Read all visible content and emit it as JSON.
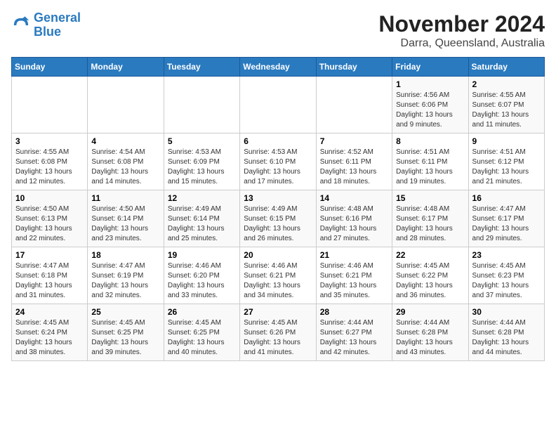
{
  "header": {
    "logo_line1": "General",
    "logo_line2": "Blue",
    "month": "November 2024",
    "location": "Darra, Queensland, Australia"
  },
  "weekdays": [
    "Sunday",
    "Monday",
    "Tuesday",
    "Wednesday",
    "Thursday",
    "Friday",
    "Saturday"
  ],
  "weeks": [
    [
      {
        "day": "",
        "info": ""
      },
      {
        "day": "",
        "info": ""
      },
      {
        "day": "",
        "info": ""
      },
      {
        "day": "",
        "info": ""
      },
      {
        "day": "",
        "info": ""
      },
      {
        "day": "1",
        "info": "Sunrise: 4:56 AM\nSunset: 6:06 PM\nDaylight: 13 hours\nand 9 minutes."
      },
      {
        "day": "2",
        "info": "Sunrise: 4:55 AM\nSunset: 6:07 PM\nDaylight: 13 hours\nand 11 minutes."
      }
    ],
    [
      {
        "day": "3",
        "info": "Sunrise: 4:55 AM\nSunset: 6:08 PM\nDaylight: 13 hours\nand 12 minutes."
      },
      {
        "day": "4",
        "info": "Sunrise: 4:54 AM\nSunset: 6:08 PM\nDaylight: 13 hours\nand 14 minutes."
      },
      {
        "day": "5",
        "info": "Sunrise: 4:53 AM\nSunset: 6:09 PM\nDaylight: 13 hours\nand 15 minutes."
      },
      {
        "day": "6",
        "info": "Sunrise: 4:53 AM\nSunset: 6:10 PM\nDaylight: 13 hours\nand 17 minutes."
      },
      {
        "day": "7",
        "info": "Sunrise: 4:52 AM\nSunset: 6:11 PM\nDaylight: 13 hours\nand 18 minutes."
      },
      {
        "day": "8",
        "info": "Sunrise: 4:51 AM\nSunset: 6:11 PM\nDaylight: 13 hours\nand 19 minutes."
      },
      {
        "day": "9",
        "info": "Sunrise: 4:51 AM\nSunset: 6:12 PM\nDaylight: 13 hours\nand 21 minutes."
      }
    ],
    [
      {
        "day": "10",
        "info": "Sunrise: 4:50 AM\nSunset: 6:13 PM\nDaylight: 13 hours\nand 22 minutes."
      },
      {
        "day": "11",
        "info": "Sunrise: 4:50 AM\nSunset: 6:14 PM\nDaylight: 13 hours\nand 23 minutes."
      },
      {
        "day": "12",
        "info": "Sunrise: 4:49 AM\nSunset: 6:14 PM\nDaylight: 13 hours\nand 25 minutes."
      },
      {
        "day": "13",
        "info": "Sunrise: 4:49 AM\nSunset: 6:15 PM\nDaylight: 13 hours\nand 26 minutes."
      },
      {
        "day": "14",
        "info": "Sunrise: 4:48 AM\nSunset: 6:16 PM\nDaylight: 13 hours\nand 27 minutes."
      },
      {
        "day": "15",
        "info": "Sunrise: 4:48 AM\nSunset: 6:17 PM\nDaylight: 13 hours\nand 28 minutes."
      },
      {
        "day": "16",
        "info": "Sunrise: 4:47 AM\nSunset: 6:17 PM\nDaylight: 13 hours\nand 29 minutes."
      }
    ],
    [
      {
        "day": "17",
        "info": "Sunrise: 4:47 AM\nSunset: 6:18 PM\nDaylight: 13 hours\nand 31 minutes."
      },
      {
        "day": "18",
        "info": "Sunrise: 4:47 AM\nSunset: 6:19 PM\nDaylight: 13 hours\nand 32 minutes."
      },
      {
        "day": "19",
        "info": "Sunrise: 4:46 AM\nSunset: 6:20 PM\nDaylight: 13 hours\nand 33 minutes."
      },
      {
        "day": "20",
        "info": "Sunrise: 4:46 AM\nSunset: 6:21 PM\nDaylight: 13 hours\nand 34 minutes."
      },
      {
        "day": "21",
        "info": "Sunrise: 4:46 AM\nSunset: 6:21 PM\nDaylight: 13 hours\nand 35 minutes."
      },
      {
        "day": "22",
        "info": "Sunrise: 4:45 AM\nSunset: 6:22 PM\nDaylight: 13 hours\nand 36 minutes."
      },
      {
        "day": "23",
        "info": "Sunrise: 4:45 AM\nSunset: 6:23 PM\nDaylight: 13 hours\nand 37 minutes."
      }
    ],
    [
      {
        "day": "24",
        "info": "Sunrise: 4:45 AM\nSunset: 6:24 PM\nDaylight: 13 hours\nand 38 minutes."
      },
      {
        "day": "25",
        "info": "Sunrise: 4:45 AM\nSunset: 6:25 PM\nDaylight: 13 hours\nand 39 minutes."
      },
      {
        "day": "26",
        "info": "Sunrise: 4:45 AM\nSunset: 6:25 PM\nDaylight: 13 hours\nand 40 minutes."
      },
      {
        "day": "27",
        "info": "Sunrise: 4:45 AM\nSunset: 6:26 PM\nDaylight: 13 hours\nand 41 minutes."
      },
      {
        "day": "28",
        "info": "Sunrise: 4:44 AM\nSunset: 6:27 PM\nDaylight: 13 hours\nand 42 minutes."
      },
      {
        "day": "29",
        "info": "Sunrise: 4:44 AM\nSunset: 6:28 PM\nDaylight: 13 hours\nand 43 minutes."
      },
      {
        "day": "30",
        "info": "Sunrise: 4:44 AM\nSunset: 6:28 PM\nDaylight: 13 hours\nand 44 minutes."
      }
    ]
  ]
}
